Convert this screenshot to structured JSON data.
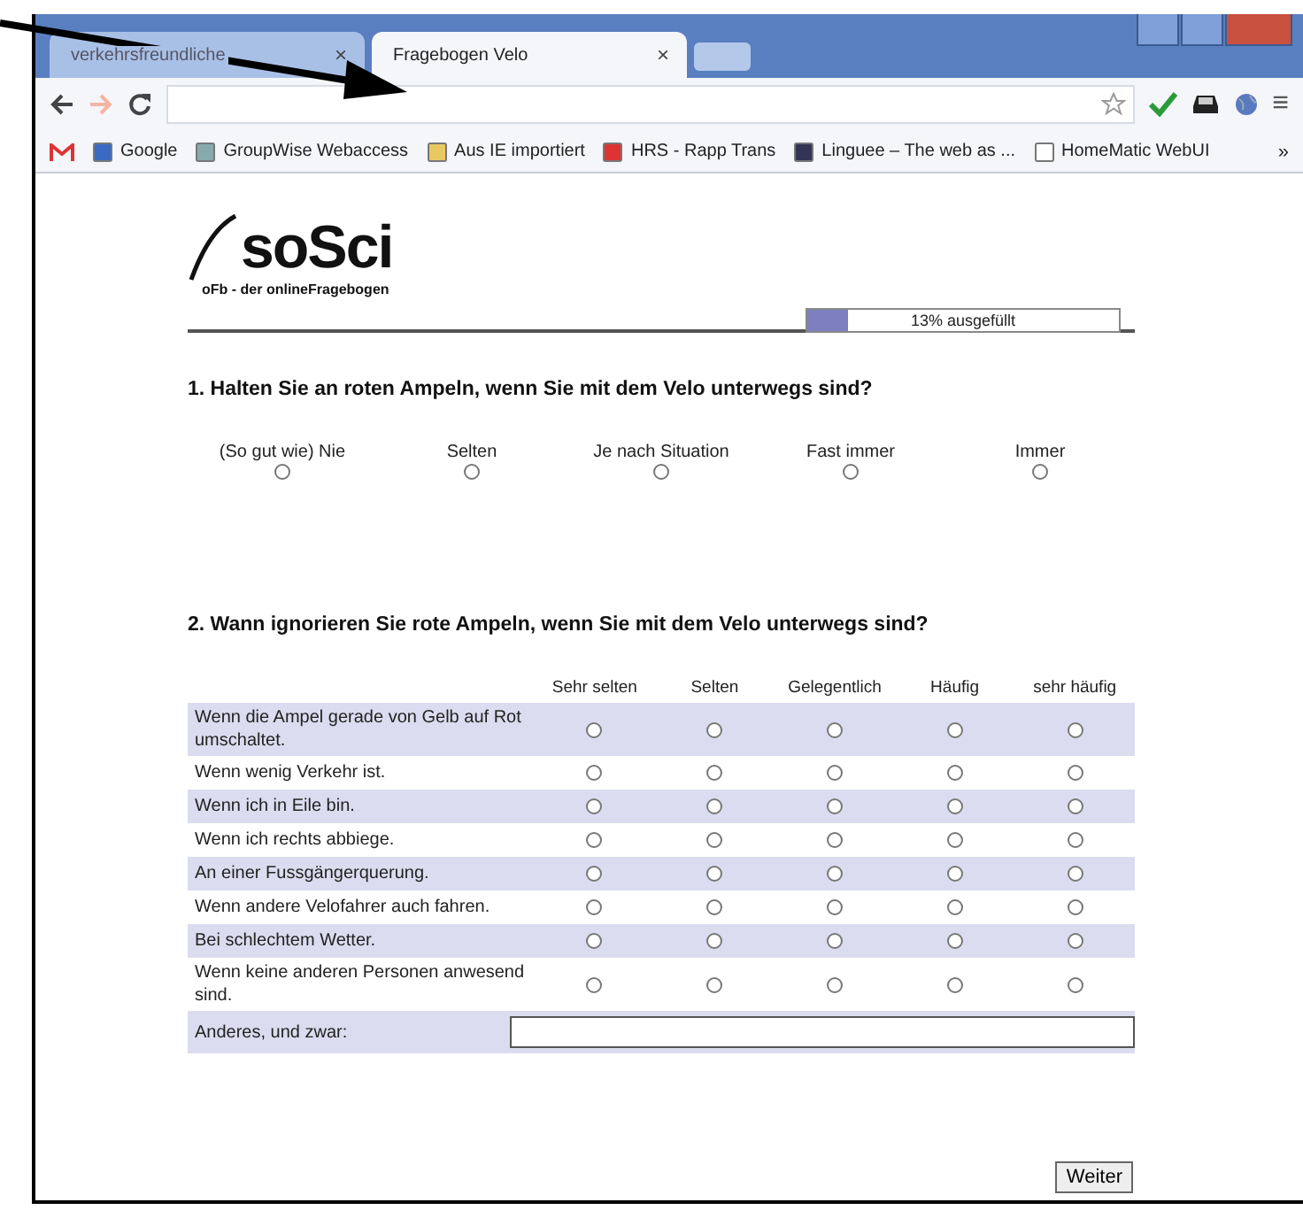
{
  "browser": {
    "tabs": [
      {
        "title": "verkehrsfreundliche",
        "selected": false
      },
      {
        "title": "Fragebogen Velo",
        "selected": true
      }
    ],
    "close_glyph": "×",
    "menu_glyph": "≡",
    "more_glyph": "»",
    "bookmarks": [
      {
        "label": "Google"
      },
      {
        "label": "GroupWise Webaccess"
      },
      {
        "label": "Aus IE importiert"
      },
      {
        "label": "HRS - Rapp Trans"
      },
      {
        "label": "Linguee – The web as ..."
      },
      {
        "label": "HomeMatic WebUI"
      }
    ]
  },
  "logo": {
    "wordmark": "soSci",
    "tagline": "oFb - der onlineFragebogen"
  },
  "progress": {
    "level": 0.13,
    "label": "13% ausgefüllt"
  },
  "question1": {
    "title": "1. Halten Sie an roten Ampeln, wenn Sie mit dem Velo unterwegs sind?",
    "options": [
      {
        "label": "(So gut wie) Nie",
        "selected": false
      },
      {
        "label": "Selten",
        "selected": false
      },
      {
        "label": "Je nach Situation",
        "selected": false
      },
      {
        "label": "Fast immer",
        "selected": false
      },
      {
        "label": "Immer",
        "selected": false
      }
    ]
  },
  "question2": {
    "title": "2. Wann ignorieren Sie rote Ampeln, wenn Sie mit dem Velo unterwegs sind?",
    "columns": [
      "Sehr selten",
      "Selten",
      "Gelegentlich",
      "Häufig",
      "sehr häufig"
    ],
    "rows": [
      {
        "label": "Wenn die Ampel gerade von Gelb auf Rot umschaltet.",
        "choices": [
          {
            "selected": false
          },
          {
            "selected": false
          },
          {
            "selected": false
          },
          {
            "selected": false
          },
          {
            "selected": false
          }
        ]
      },
      {
        "label": "Wenn wenig Verkehr ist.",
        "choices": [
          {
            "selected": false
          },
          {
            "selected": false
          },
          {
            "selected": false
          },
          {
            "selected": false
          },
          {
            "selected": false
          }
        ]
      },
      {
        "label": "Wenn ich in Eile bin.",
        "choices": [
          {
            "selected": false
          },
          {
            "selected": false
          },
          {
            "selected": false
          },
          {
            "selected": false
          },
          {
            "selected": false
          }
        ]
      },
      {
        "label": "Wenn ich rechts abbiege.",
        "choices": [
          {
            "selected": false
          },
          {
            "selected": false
          },
          {
            "selected": false
          },
          {
            "selected": false
          },
          {
            "selected": false
          }
        ]
      },
      {
        "label": "An einer Fussgängerquerung.",
        "choices": [
          {
            "selected": false
          },
          {
            "selected": false
          },
          {
            "selected": false
          },
          {
            "selected": false
          },
          {
            "selected": false
          }
        ]
      },
      {
        "label": "Wenn andere Velofahrer auch fahren.",
        "choices": [
          {
            "selected": false
          },
          {
            "selected": false
          },
          {
            "selected": false
          },
          {
            "selected": false
          },
          {
            "selected": false
          }
        ]
      },
      {
        "label": "Bei schlechtem Wetter.",
        "choices": [
          {
            "selected": false
          },
          {
            "selected": false
          },
          {
            "selected": false
          },
          {
            "selected": false
          },
          {
            "selected": false
          }
        ]
      },
      {
        "label": "Wenn keine anderen Personen anwesend sind.",
        "choices": [
          {
            "selected": false
          },
          {
            "selected": false
          },
          {
            "selected": false
          },
          {
            "selected": false
          },
          {
            "selected": false
          }
        ]
      }
    ],
    "other_label": "Anderes, und zwar:"
  },
  "next_button": "Weiter"
}
